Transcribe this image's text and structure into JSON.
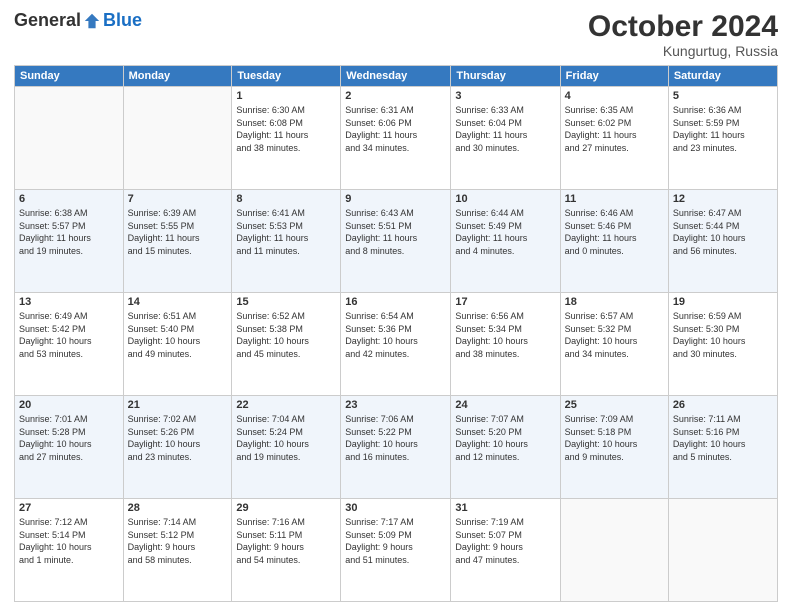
{
  "header": {
    "logo_general": "General",
    "logo_blue": "Blue",
    "month": "October 2024",
    "location": "Kungurtug, Russia"
  },
  "days_of_week": [
    "Sunday",
    "Monday",
    "Tuesday",
    "Wednesday",
    "Thursday",
    "Friday",
    "Saturday"
  ],
  "weeks": [
    [
      {
        "day": "",
        "content": ""
      },
      {
        "day": "",
        "content": ""
      },
      {
        "day": "1",
        "content": "Sunrise: 6:30 AM\nSunset: 6:08 PM\nDaylight: 11 hours\nand 38 minutes."
      },
      {
        "day": "2",
        "content": "Sunrise: 6:31 AM\nSunset: 6:06 PM\nDaylight: 11 hours\nand 34 minutes."
      },
      {
        "day": "3",
        "content": "Sunrise: 6:33 AM\nSunset: 6:04 PM\nDaylight: 11 hours\nand 30 minutes."
      },
      {
        "day": "4",
        "content": "Sunrise: 6:35 AM\nSunset: 6:02 PM\nDaylight: 11 hours\nand 27 minutes."
      },
      {
        "day": "5",
        "content": "Sunrise: 6:36 AM\nSunset: 5:59 PM\nDaylight: 11 hours\nand 23 minutes."
      }
    ],
    [
      {
        "day": "6",
        "content": "Sunrise: 6:38 AM\nSunset: 5:57 PM\nDaylight: 11 hours\nand 19 minutes."
      },
      {
        "day": "7",
        "content": "Sunrise: 6:39 AM\nSunset: 5:55 PM\nDaylight: 11 hours\nand 15 minutes."
      },
      {
        "day": "8",
        "content": "Sunrise: 6:41 AM\nSunset: 5:53 PM\nDaylight: 11 hours\nand 11 minutes."
      },
      {
        "day": "9",
        "content": "Sunrise: 6:43 AM\nSunset: 5:51 PM\nDaylight: 11 hours\nand 8 minutes."
      },
      {
        "day": "10",
        "content": "Sunrise: 6:44 AM\nSunset: 5:49 PM\nDaylight: 11 hours\nand 4 minutes."
      },
      {
        "day": "11",
        "content": "Sunrise: 6:46 AM\nSunset: 5:46 PM\nDaylight: 11 hours\nand 0 minutes."
      },
      {
        "day": "12",
        "content": "Sunrise: 6:47 AM\nSunset: 5:44 PM\nDaylight: 10 hours\nand 56 minutes."
      }
    ],
    [
      {
        "day": "13",
        "content": "Sunrise: 6:49 AM\nSunset: 5:42 PM\nDaylight: 10 hours\nand 53 minutes."
      },
      {
        "day": "14",
        "content": "Sunrise: 6:51 AM\nSunset: 5:40 PM\nDaylight: 10 hours\nand 49 minutes."
      },
      {
        "day": "15",
        "content": "Sunrise: 6:52 AM\nSunset: 5:38 PM\nDaylight: 10 hours\nand 45 minutes."
      },
      {
        "day": "16",
        "content": "Sunrise: 6:54 AM\nSunset: 5:36 PM\nDaylight: 10 hours\nand 42 minutes."
      },
      {
        "day": "17",
        "content": "Sunrise: 6:56 AM\nSunset: 5:34 PM\nDaylight: 10 hours\nand 38 minutes."
      },
      {
        "day": "18",
        "content": "Sunrise: 6:57 AM\nSunset: 5:32 PM\nDaylight: 10 hours\nand 34 minutes."
      },
      {
        "day": "19",
        "content": "Sunrise: 6:59 AM\nSunset: 5:30 PM\nDaylight: 10 hours\nand 30 minutes."
      }
    ],
    [
      {
        "day": "20",
        "content": "Sunrise: 7:01 AM\nSunset: 5:28 PM\nDaylight: 10 hours\nand 27 minutes."
      },
      {
        "day": "21",
        "content": "Sunrise: 7:02 AM\nSunset: 5:26 PM\nDaylight: 10 hours\nand 23 minutes."
      },
      {
        "day": "22",
        "content": "Sunrise: 7:04 AM\nSunset: 5:24 PM\nDaylight: 10 hours\nand 19 minutes."
      },
      {
        "day": "23",
        "content": "Sunrise: 7:06 AM\nSunset: 5:22 PM\nDaylight: 10 hours\nand 16 minutes."
      },
      {
        "day": "24",
        "content": "Sunrise: 7:07 AM\nSunset: 5:20 PM\nDaylight: 10 hours\nand 12 minutes."
      },
      {
        "day": "25",
        "content": "Sunrise: 7:09 AM\nSunset: 5:18 PM\nDaylight: 10 hours\nand 9 minutes."
      },
      {
        "day": "26",
        "content": "Sunrise: 7:11 AM\nSunset: 5:16 PM\nDaylight: 10 hours\nand 5 minutes."
      }
    ],
    [
      {
        "day": "27",
        "content": "Sunrise: 7:12 AM\nSunset: 5:14 PM\nDaylight: 10 hours\nand 1 minute."
      },
      {
        "day": "28",
        "content": "Sunrise: 7:14 AM\nSunset: 5:12 PM\nDaylight: 9 hours\nand 58 minutes."
      },
      {
        "day": "29",
        "content": "Sunrise: 7:16 AM\nSunset: 5:11 PM\nDaylight: 9 hours\nand 54 minutes."
      },
      {
        "day": "30",
        "content": "Sunrise: 7:17 AM\nSunset: 5:09 PM\nDaylight: 9 hours\nand 51 minutes."
      },
      {
        "day": "31",
        "content": "Sunrise: 7:19 AM\nSunset: 5:07 PM\nDaylight: 9 hours\nand 47 minutes."
      },
      {
        "day": "",
        "content": ""
      },
      {
        "day": "",
        "content": ""
      }
    ]
  ]
}
